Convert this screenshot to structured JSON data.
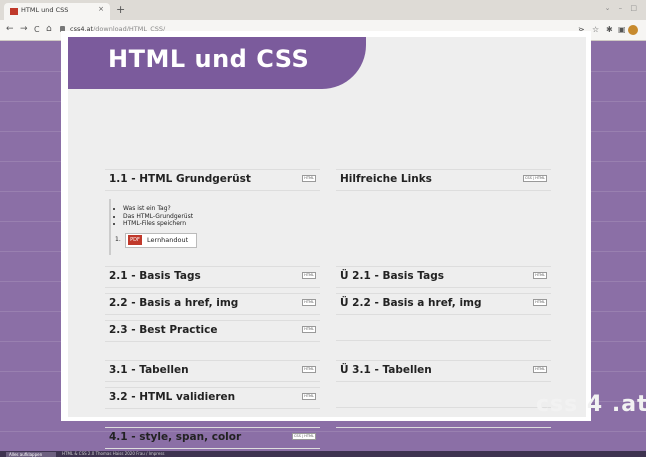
{
  "browser": {
    "tab_title": "HTML und CSS",
    "tab_close": "×",
    "new_tab": "+",
    "window_controls": "⌄ – □",
    "nav": {
      "back": "←",
      "forward": "→",
      "reload": "C",
      "home": "⌂"
    },
    "url_domain": "css4.at",
    "url_path": "/download/HTML_CSS/",
    "right_icons": {
      "send": "⋗",
      "star": "☆",
      "extensions": "✱",
      "sidebar": "▣"
    }
  },
  "page": {
    "title": "HTML und CSS",
    "left_sections": [
      {
        "title": "1.1 - HTML Grundgerüst",
        "badge": "HTML"
      },
      {
        "title": "2.1 - Basis Tags",
        "badge": "HTML"
      },
      {
        "title": "2.2 - Basis a href, img",
        "badge": "HTML"
      },
      {
        "title": "2.3 - Best Practice",
        "badge": "HTML"
      },
      {
        "title": "3.1 - Tabellen",
        "badge": "HTML"
      },
      {
        "title": "3.2 - HTML validieren",
        "badge": "HTML"
      },
      {
        "title": "4.1 - style, span, color",
        "badge": "CSS | HTML"
      }
    ],
    "right_sections": [
      {
        "title": "Hilfreiche Links",
        "badge": "CSS | HTML"
      },
      {
        "title": "Ü 2.1 - Basis Tags",
        "badge": "HTML"
      },
      {
        "title": "Ü 2.2 - Basis a href, img",
        "badge": "HTML"
      },
      {
        "title": "",
        "badge": ""
      },
      {
        "title": "Ü 3.1 - Tabellen",
        "badge": "HTML"
      },
      {
        "title": "",
        "badge": ""
      },
      {
        "title": "",
        "badge": ""
      }
    ],
    "expanded": {
      "items": [
        "Was ist ein Tag?",
        "Das HTML-Grundgerüst",
        "HTML-Files speichern"
      ],
      "number": "1.",
      "pdf_icon": "PDF",
      "pdf_label": "Lernhandout"
    },
    "brand": "css 4 .at",
    "footer_button": "Alles aufklappen",
    "footer_text": "HTML & CSS 2.0 Thomas Haiss 2020 Frau / Impress"
  }
}
